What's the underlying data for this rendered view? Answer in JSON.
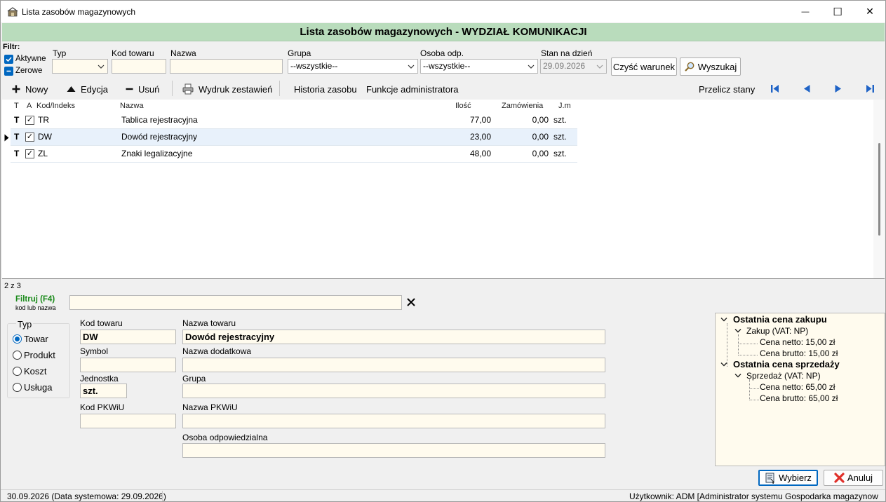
{
  "window": {
    "title": "Lista zasobów magazynowych",
    "header": "Lista zasobów magazynowych - WYDZIAŁ KOMUNIKACJI",
    "controls": {
      "minimize": "—",
      "maximize": "☐",
      "close": "✕"
    }
  },
  "filter": {
    "label": "Filtr:",
    "active_label": "Aktywne",
    "zero_label": "Zerowe",
    "type_label": "Typ",
    "type_value": "",
    "code_label": "Kod towaru",
    "code_value": "",
    "name_label": "Nazwa",
    "name_value": "",
    "group_label": "Grupa",
    "group_value": "--wszystkie--",
    "person_label": "Osoba odp.",
    "person_value": "--wszystkie--",
    "date_label": "Stan na dzień",
    "date_value": "29.09.2026",
    "clear_button": "Czyść warunek",
    "search_button": "Wyszukaj"
  },
  "toolbar": {
    "new": "Nowy",
    "edit": "Edycja",
    "delete": "Usuń",
    "print": "Wydruk zestawień",
    "history": "Historia zasobu",
    "admin": "Funkcje administratora",
    "recalc": "Przelicz stany"
  },
  "grid": {
    "columns": {
      "t": "T",
      "a": "A",
      "code": "Kod/Indeks",
      "name": "Nazwa",
      "qty": "Ilość",
      "orders": "Zamówienia",
      "unit": "J.m"
    },
    "rows": [
      {
        "t": "T",
        "code": "TR",
        "name": "Tablica rejestracyjna",
        "qty": "77,00",
        "orders": "0,00",
        "unit": "szt."
      },
      {
        "t": "T",
        "code": "DW",
        "name": "Dowód rejestracyjny",
        "qty": "23,00",
        "orders": "0,00",
        "unit": "szt."
      },
      {
        "t": "T",
        "code": "ZL",
        "name": "Znaki legalizacyjne",
        "qty": "48,00",
        "orders": "0,00",
        "unit": "szt."
      }
    ],
    "record_counter": "2 z 3"
  },
  "quickfilter": {
    "label": "Filtruj (F4)",
    "sublabel": "kod lub nazwa",
    "value": ""
  },
  "details": {
    "type_group": "Typ",
    "types": [
      "Towar",
      "Produkt",
      "Koszt",
      "Usługa"
    ],
    "selected_type": "Towar",
    "code_label": "Kod towaru",
    "code_value": "DW",
    "name_label": "Nazwa towaru",
    "name_value": "Dowód rejestracyjny",
    "symbol_label": "Symbol",
    "symbol_value": "",
    "extra_name_label": "Nazwa dodatkowa",
    "extra_name_value": "",
    "unit_label": "Jednostka",
    "unit_value": "szt.",
    "group_label": "Grupa",
    "group_value": "",
    "pkwiu_label": "Kod PKWiU",
    "pkwiu_value": "",
    "pkwiu_name_label": "Nazwa PKWiU",
    "pkwiu_name_value": "",
    "person_label": "Osoba odpowiedzialna",
    "person_value": ""
  },
  "prices": {
    "purchase_header": "Ostatnia cena zakupu",
    "purchase_node": "Zakup (VAT: NP)",
    "purchase_net": "Cena netto: 15,00 zł",
    "purchase_gross": "Cena brutto: 15,00 zł",
    "sale_header": "Ostatnia cena sprzedaży",
    "sale_node": "Sprzedaż (VAT: NP)",
    "sale_net": "Cena netto: 65,00 zł",
    "sale_gross": "Cena brutto: 65,00 zł"
  },
  "actions": {
    "select": "Wybierz",
    "cancel": "Anuluj"
  },
  "status": {
    "date": "30.09.2026 (Data systemowa: 29.09.2026)",
    "user": "Użytkownik: ADM [Administrator systemu Gospodarka magazynow"
  },
  "colors": {
    "header_band": "#b9dcbc",
    "input_bg": "#fffbee",
    "accent": "#0067c0",
    "filter_label": "#1a8a1a"
  }
}
